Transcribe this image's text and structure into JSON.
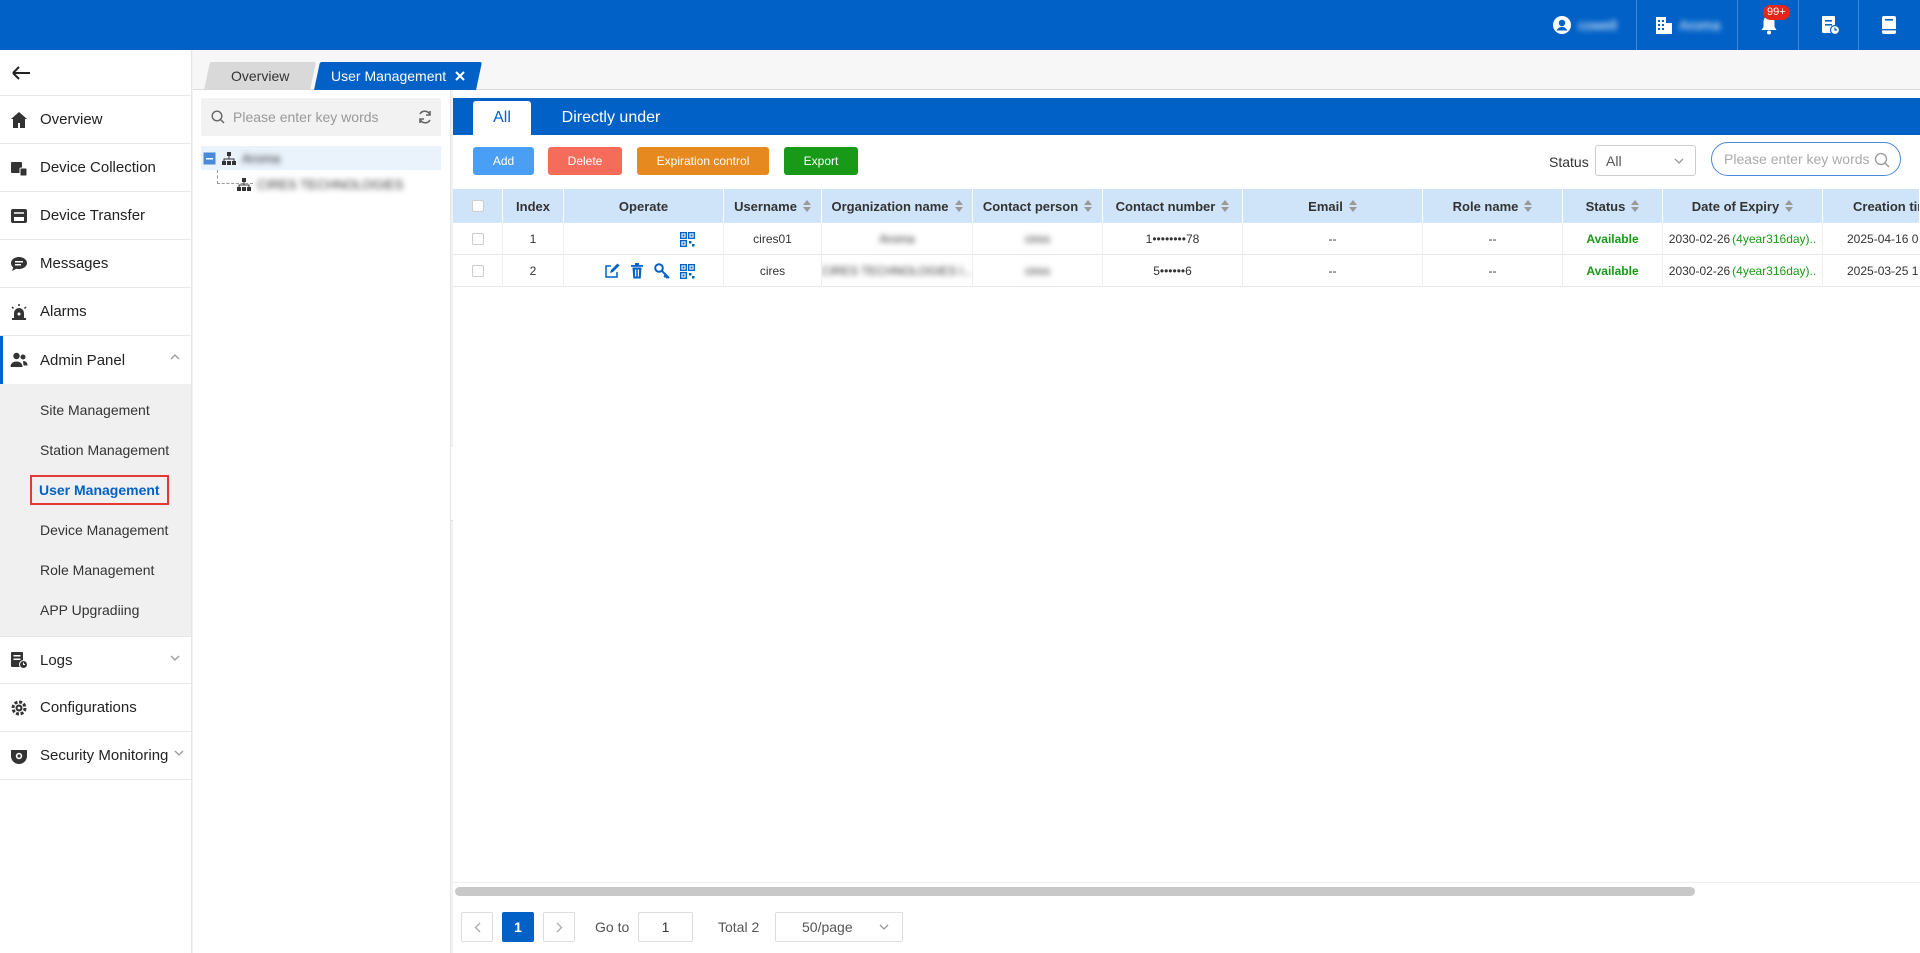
{
  "topbar": {
    "user_name": "cowell",
    "org_name": "Aroma",
    "notification_badge": "99+"
  },
  "sidebar": {
    "items": [
      {
        "label": "Overview",
        "icon": "home-icon"
      },
      {
        "label": "Device Collection",
        "icon": "device-collection-icon"
      },
      {
        "label": "Device Transfer",
        "icon": "device-transfer-icon"
      },
      {
        "label": "Messages",
        "icon": "message-icon"
      },
      {
        "label": "Alarms",
        "icon": "alarm-icon"
      },
      {
        "label": "Admin Panel",
        "icon": "users-icon"
      },
      {
        "label": "Logs",
        "icon": "logs-icon"
      },
      {
        "label": "Configurations",
        "icon": "gear-icon"
      },
      {
        "label": "Security Monitoring",
        "icon": "camera-icon"
      }
    ],
    "admin_sub": [
      "Site Management",
      "Station Management",
      "User Management",
      "Device Management",
      "Role Management",
      "APP Upgradiing"
    ]
  },
  "page_tabs": {
    "overview": "Overview",
    "current": "User Management"
  },
  "tree": {
    "search_placeholder": "Please enter key words",
    "root": "Aroma",
    "child": "CIRES TECHNOLOGIES"
  },
  "content_tabs": {
    "all": "All",
    "direct": "Directly under"
  },
  "toolbar": {
    "add": "Add",
    "delete": "Delete",
    "expiration": "Expiration control",
    "export": "Export",
    "status_label": "Status",
    "status_value": "All",
    "search_placeholder": "Please enter key words"
  },
  "table": {
    "headers": {
      "index": "Index",
      "operate": "Operate",
      "username": "Username",
      "org": "Organization name",
      "contact": "Contact person",
      "number": "Contact number",
      "email": "Email",
      "role": "Role name",
      "status": "Status",
      "expiry": "Date of Expiry",
      "created": "Creation tim"
    },
    "rows": [
      {
        "index": "1",
        "username": "cires01",
        "org": "Aroma",
        "contact": "cires",
        "number": "1••••••••78",
        "email": "--",
        "role": "--",
        "status": "Available",
        "expiry_date": "2030-02-26",
        "expiry_left": "(4year316day)..",
        "created": "2025-04-16 0"
      },
      {
        "index": "2",
        "username": "cires",
        "org": "CIRES TECHNOLOGIES l...",
        "contact": "cires",
        "number": "5••••••6",
        "email": "--",
        "role": "--",
        "status": "Available",
        "expiry_date": "2030-02-26",
        "expiry_left": "(4year316day)..",
        "created": "2025-03-25 1"
      }
    ]
  },
  "pagination": {
    "current": "1",
    "goto_label": "Go to",
    "goto_value": "1",
    "total": "Total 2",
    "per_page": "50/page"
  },
  "colors": {
    "primary": "#0161c7",
    "available": "#189a18",
    "add": "#4a9ff5",
    "delete": "#f56c5b",
    "expiration": "#e6891f",
    "export": "#189a18"
  }
}
